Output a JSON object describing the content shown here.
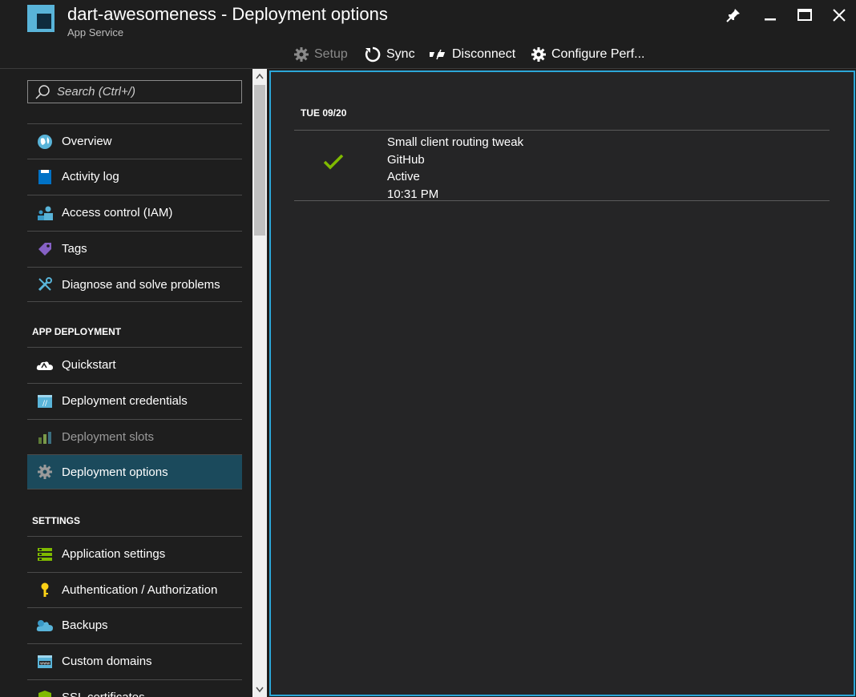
{
  "window": {
    "title": "dart-awesomeness - Deployment options",
    "subtitle": "App Service"
  },
  "toolbar": {
    "setup": "Setup",
    "sync": "Sync",
    "disconnect": "Disconnect",
    "configure": "Configure Perf..."
  },
  "search": {
    "placeholder": "Search (Ctrl+/)"
  },
  "nav": {
    "items_top": [
      {
        "label": "Overview",
        "icon": "globe-icon"
      },
      {
        "label": "Activity log",
        "icon": "log-icon"
      },
      {
        "label": "Access control (IAM)",
        "icon": "users-icon"
      },
      {
        "label": "Tags",
        "icon": "tag-icon"
      },
      {
        "label": "Diagnose and solve problems",
        "icon": "wrench-icon"
      }
    ],
    "section_deployment": "APP DEPLOYMENT",
    "items_deployment": [
      {
        "label": "Quickstart",
        "icon": "cloud-icon"
      },
      {
        "label": "Deployment credentials",
        "icon": "credentials-icon"
      },
      {
        "label": "Deployment slots",
        "icon": "slots-icon"
      },
      {
        "label": "Deployment options",
        "icon": "gear-icon"
      }
    ],
    "section_settings": "SETTINGS",
    "items_settings": [
      {
        "label": "Application settings",
        "icon": "settings-list-icon"
      },
      {
        "label": "Authentication / Authorization",
        "icon": "key-icon"
      },
      {
        "label": "Backups",
        "icon": "backup-cloud-icon"
      },
      {
        "label": "Custom domains",
        "icon": "www-icon"
      },
      {
        "label": "SSL certificates",
        "icon": "shield-icon"
      }
    ]
  },
  "deployments": {
    "date": "TUE 09/20",
    "entry": {
      "message": "Small client routing tweak",
      "source": "GitHub",
      "status": "Active",
      "time": "10:31 PM",
      "status_icon": "checkmark-icon"
    }
  },
  "colors": {
    "accent": "#2ca7d8",
    "selected": "#1b4a5c",
    "success": "#7fba00",
    "background": "#1e1e1e"
  }
}
